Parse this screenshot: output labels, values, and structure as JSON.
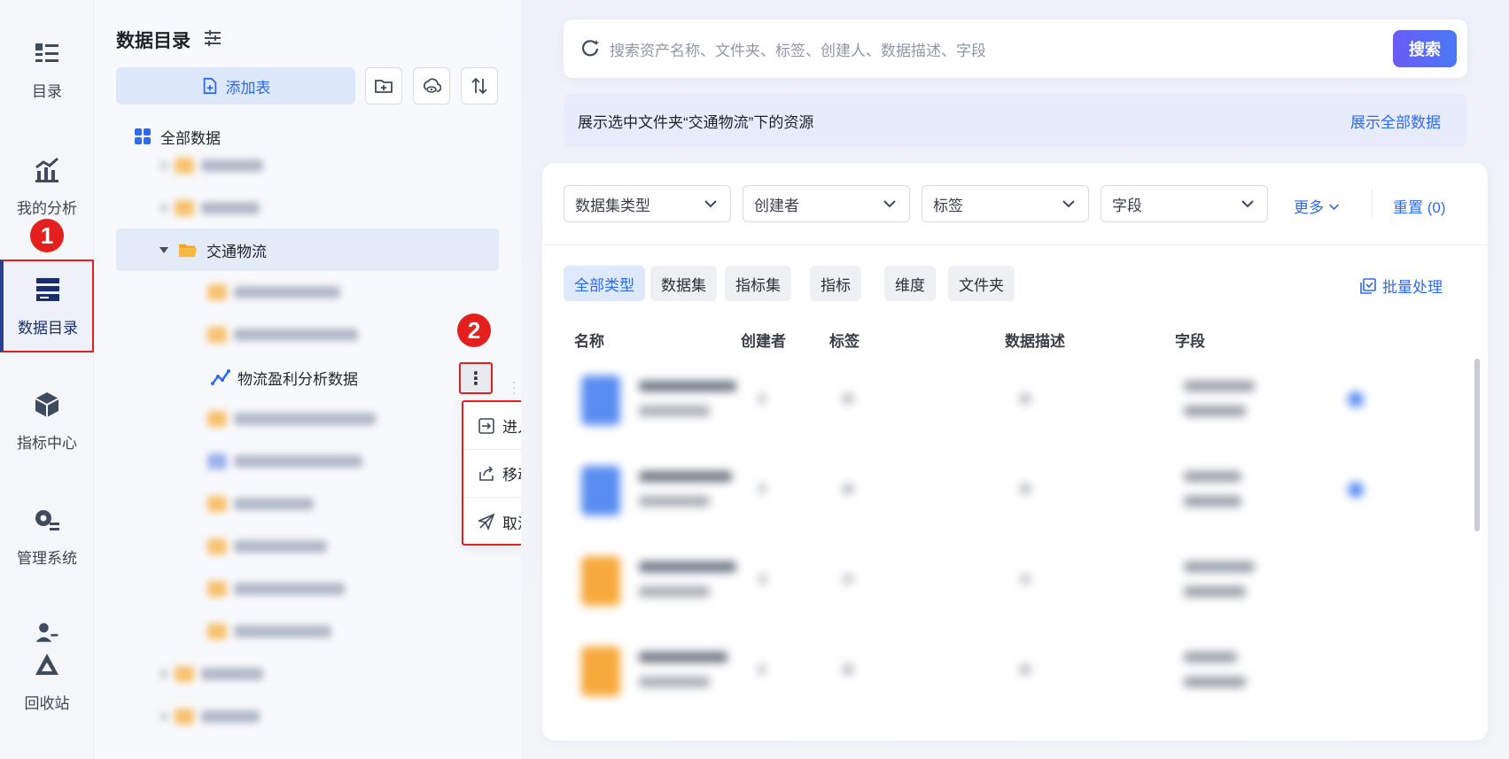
{
  "nav": {
    "items": [
      {
        "label": "目录",
        "icon": "catalog-icon"
      },
      {
        "label": "我的分析",
        "icon": "analysis-chart-icon"
      },
      {
        "label": "数据目录",
        "icon": "data-catalog-icon",
        "active": true
      },
      {
        "label": "指标中心",
        "icon": "cube-icon"
      },
      {
        "label": "管理系统",
        "icon": "gear-list-icon"
      },
      {
        "label": "回收站",
        "icon": "recycle-icon"
      }
    ]
  },
  "annotations": {
    "step1": "1",
    "step2": "2"
  },
  "panel": {
    "title": "数据目录",
    "add_table": "添加表",
    "tree": {
      "root": "全部数据",
      "selected_folder": "交通物流",
      "dataset_item": "物流盈利分析数据"
    },
    "more_glyph": "⋮",
    "context_menu": {
      "items": [
        {
          "label": "进入我的分析",
          "icon": "enter-icon"
        },
        {
          "label": "移动到",
          "icon": "move-icon"
        },
        {
          "label": "取消发布",
          "icon": "unpublish-icon"
        }
      ]
    }
  },
  "search": {
    "placeholder": "搜索资产名称、文件夹、标签、创建人、数据描述、字段",
    "button": "搜索"
  },
  "info_bar": {
    "text": "展示选中文件夹“交通物流”下的资源",
    "link": "展示全部数据"
  },
  "filters": {
    "dropdowns": [
      "数据集类型",
      "创建者",
      "标签",
      "字段"
    ],
    "more": "更多",
    "reset": "重置 (0)"
  },
  "type_tabs": [
    "全部类型",
    "数据集",
    "指标集",
    "指标",
    "维度",
    "文件夹"
  ],
  "batch_label": "批量处理",
  "table": {
    "columns": [
      "名称",
      "创建者",
      "标签",
      "数据描述",
      "字段"
    ]
  },
  "colors": {
    "accent": "#2f6be8",
    "highlight": "#e02020",
    "folder": "#f7b041"
  }
}
